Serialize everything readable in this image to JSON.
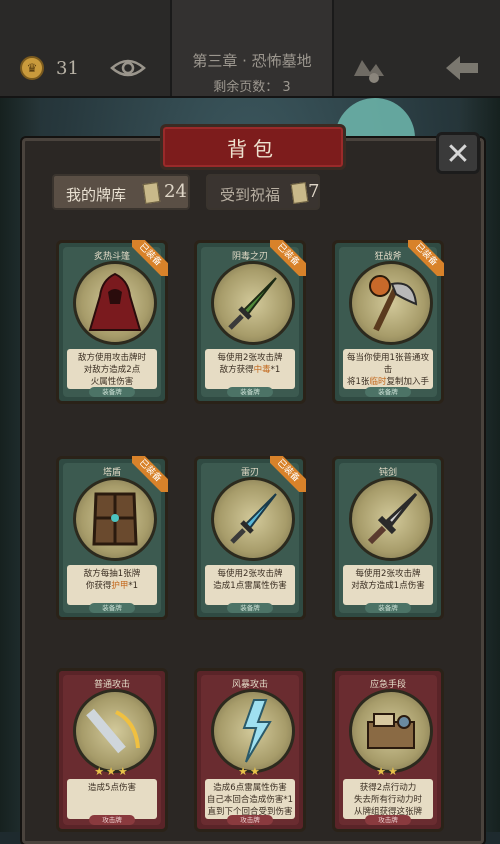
{
  "header": {
    "coins": "31",
    "chapter_title": "第三章 · 恐怖墓地",
    "pages_left": "剩余页数： 3"
  },
  "panel": {
    "title": "背包",
    "close": "✕",
    "tabs": [
      {
        "label": "我的牌库",
        "count": "24"
      },
      {
        "label": "受到祝福",
        "count": "7"
      }
    ]
  },
  "cards": [
    {
      "name": "炙热斗篷",
      "badge": "已装备",
      "desc1": "敌方使用攻击牌时",
      "desc2": "对敌方造成2点",
      "desc3": "火属性伤害",
      "foot": "装备牌"
    },
    {
      "name": "阴毒之刃",
      "badge": "已装备",
      "desc1": "每使用2张攻击牌",
      "desc2": "敌方获得",
      "desc2_hl": "中毒",
      "desc2_tail": "*1",
      "foot": "装备牌"
    },
    {
      "name": "狂战斧",
      "badge": "已装备",
      "desc1": "每当你使用1张普通攻击",
      "desc2": "将1张",
      "desc2_hl": "临时",
      "desc2_tail": "复制加入手牌",
      "foot": "装备牌"
    },
    {
      "name": "塔盾",
      "badge": "已装备",
      "desc1": "敌方每抽1张牌",
      "desc2": "你获得",
      "desc2_hl": "护甲",
      "desc2_tail": "*1",
      "foot": "装备牌"
    },
    {
      "name": "雷刃",
      "badge": "已装备",
      "desc1": "每使用2张攻击牌",
      "desc2": "造成1点雷属性伤害",
      "foot": "装备牌"
    },
    {
      "name": "钝剑",
      "badge": "",
      "desc1": "每使用2张攻击牌",
      "desc2": "对敌方造成1点伤害",
      "foot": "装备牌"
    },
    {
      "name": "普通攻击",
      "stars": "★★★",
      "desc1": "造成5点伤害",
      "desc2": "",
      "foot": "攻击牌"
    },
    {
      "name": "风暴攻击",
      "stars": "★★",
      "desc1": "造成6点雷属性伤害",
      "desc2": "自己本回合造成伤害*1",
      "desc3": "直到下个回合受到伤害*1",
      "foot": "攻击牌"
    },
    {
      "name": "应急手段",
      "stars": "★★",
      "desc1": "获得2点行动力",
      "desc2": "失去所有行动力时",
      "desc3": "从牌组获得这张牌",
      "foot": "攻击牌"
    }
  ],
  "icons": [
    "coin-icon",
    "eye-icon",
    "map-icon",
    "back-arrow-icon",
    "card-icon"
  ]
}
